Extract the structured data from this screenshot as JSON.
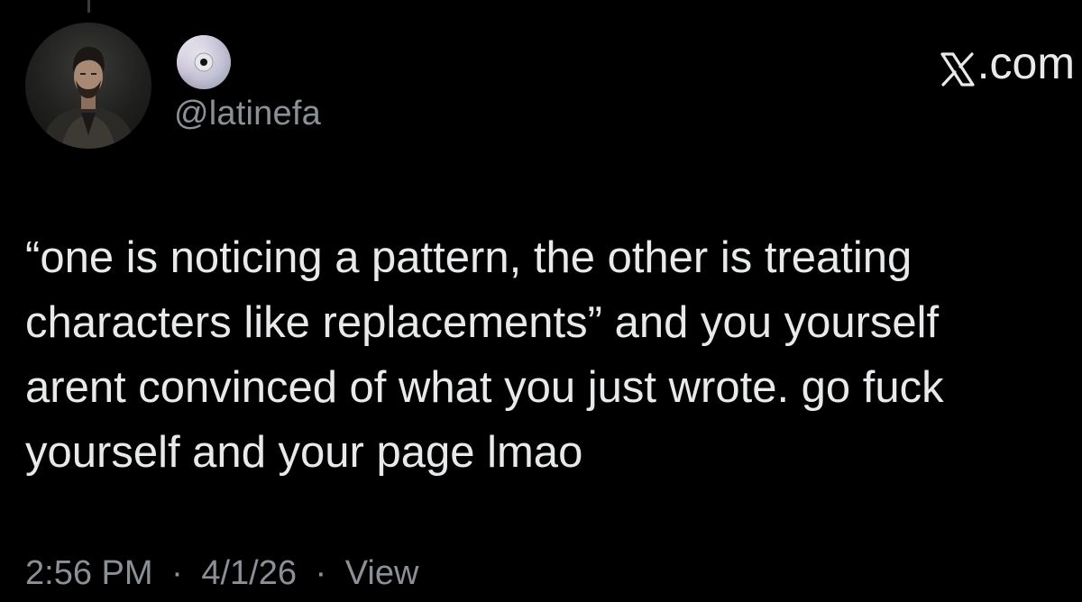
{
  "author": {
    "display_name_icon": "cd-disc-icon",
    "handle": "@latinefa",
    "avatar_icon": "avatar-portrait"
  },
  "branding": {
    "site_label": ".com",
    "site_logo_icon": "x-logo-icon"
  },
  "tweet": {
    "text": "“one is noticing a pattern, the other is treating\ncharacters like replacements” and you yourself\narent convinced of what you just wrote. go fuck\nyourself and your page lmao"
  },
  "meta": {
    "time": "2:56 PM",
    "date": "4/1/26",
    "separator": "·",
    "views_label": "View"
  },
  "colors": {
    "background": "#000000",
    "primary_text": "#e7e9ea",
    "secondary_text": "#8b9096"
  }
}
